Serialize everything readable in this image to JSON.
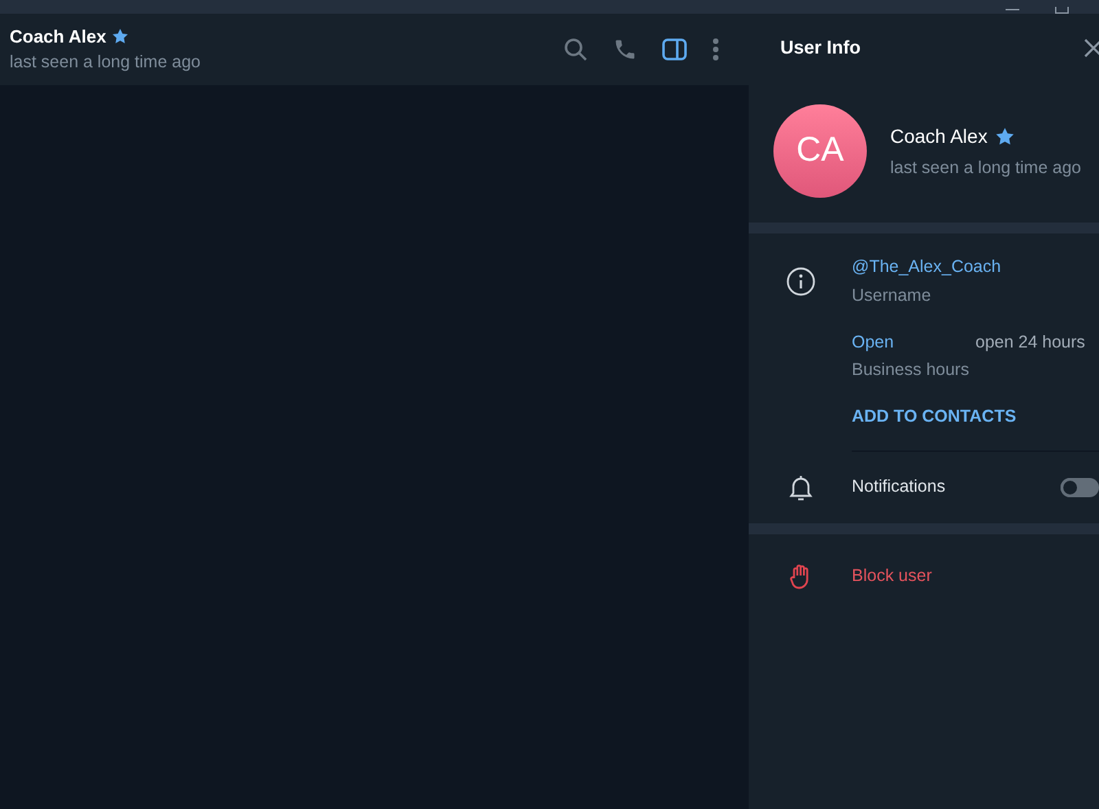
{
  "chat_header": {
    "name": "Coach Alex",
    "starred": true,
    "status": "last seen a long time ago",
    "sidebar_open": true
  },
  "user_info": {
    "title": "User Info",
    "avatar_initials": "CA",
    "name": "Coach Alex",
    "starred": true,
    "status": "last seen a long time ago",
    "username": "@The_Alex_Coach",
    "username_label": "Username",
    "hours_state": "Open",
    "hours_value": "open 24 hours",
    "hours_label": "Business hours",
    "add_contact": "ADD TO CONTACTS",
    "notifications": {
      "label": "Notifications",
      "on": false
    },
    "block": "Block user"
  }
}
